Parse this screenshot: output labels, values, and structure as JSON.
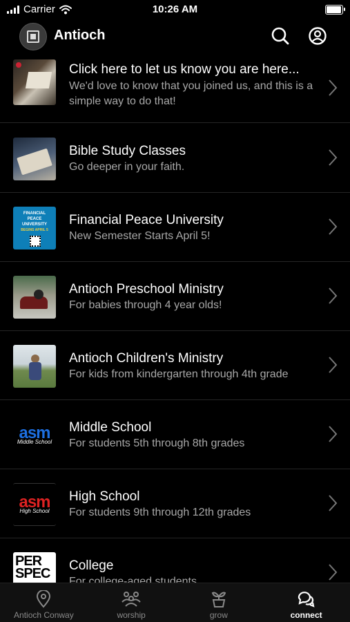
{
  "status_bar": {
    "carrier": "Carrier",
    "time": "10:26 AM",
    "battery_level": 0.95
  },
  "header": {
    "title": "Antioch"
  },
  "items": [
    {
      "title": "Click here to let us know you are here...",
      "subtitle": "We'd love to know that you joined us, and this is a simple way to do that!"
    },
    {
      "title": "Bible Study Classes",
      "subtitle": "Go deeper in your faith."
    },
    {
      "title": "Financial Peace University",
      "subtitle": "New Semester Starts April 5!",
      "thumb_text": [
        "FINANCIAL",
        "PEACE",
        "UNIVERSITY",
        "BEGINS APRIL 5"
      ]
    },
    {
      "title": "Antioch Preschool Ministry",
      "subtitle": "For babies through 4 year olds!"
    },
    {
      "title": "Antioch Children's Ministry",
      "subtitle": "For kids from kindergarten through 4th grade"
    },
    {
      "title": "Middle School",
      "subtitle": "For students 5th through 8th grades",
      "thumb_text": [
        "asm",
        "Middle School"
      ]
    },
    {
      "title": "High School",
      "subtitle": "For students 9th through 12th grades",
      "thumb_text": [
        "asm",
        "High School"
      ]
    },
    {
      "title": "College",
      "subtitle": "For college-aged students",
      "thumb_text": [
        "PER",
        "SPEC"
      ]
    }
  ],
  "tabs": [
    {
      "label": "Antioch Conway",
      "icon": "location-pin-icon"
    },
    {
      "label": "worship",
      "icon": "people-icon"
    },
    {
      "label": "grow",
      "icon": "sprout-icon"
    },
    {
      "label": "connect",
      "icon": "chat-bubbles-icon",
      "active": true
    }
  ],
  "colors": {
    "background": "#000000",
    "subtitle": "#a8a8a8",
    "divider": "#262626",
    "active_tab": "#ffffff",
    "inactive_tab": "#8a8a8a"
  }
}
